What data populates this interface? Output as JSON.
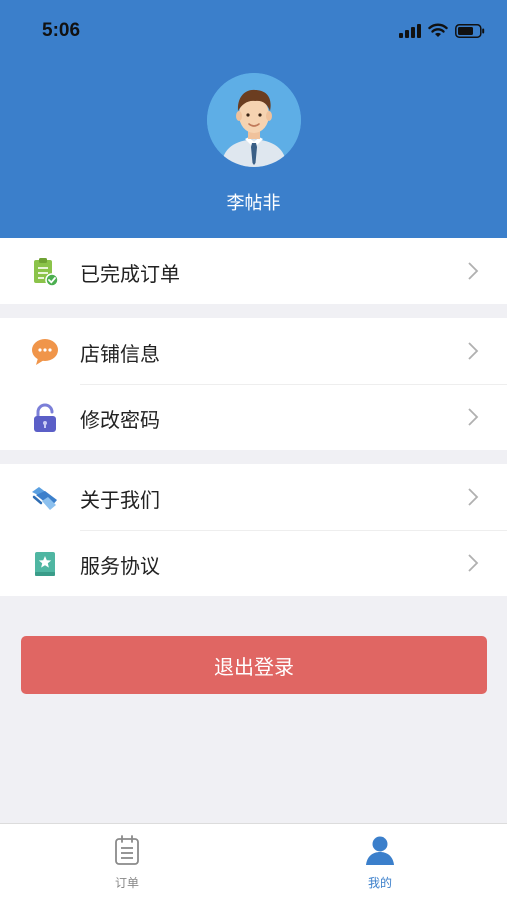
{
  "status_bar": {
    "time": "5:06"
  },
  "profile": {
    "name": "李帖非"
  },
  "menu": {
    "completed_orders": "已完成订单",
    "store_info": "店铺信息",
    "change_password": "修改密码",
    "about_us": "关于我们",
    "service_agreement": "服务协议"
  },
  "logout_label": "退出登录",
  "tabbar": {
    "orders_label": "订单",
    "mine_label": "我的"
  },
  "colors": {
    "header": "#3b7fcb",
    "logout": "#e06663",
    "tab_active": "#3b7fcb",
    "tab_inactive": "#888888"
  }
}
